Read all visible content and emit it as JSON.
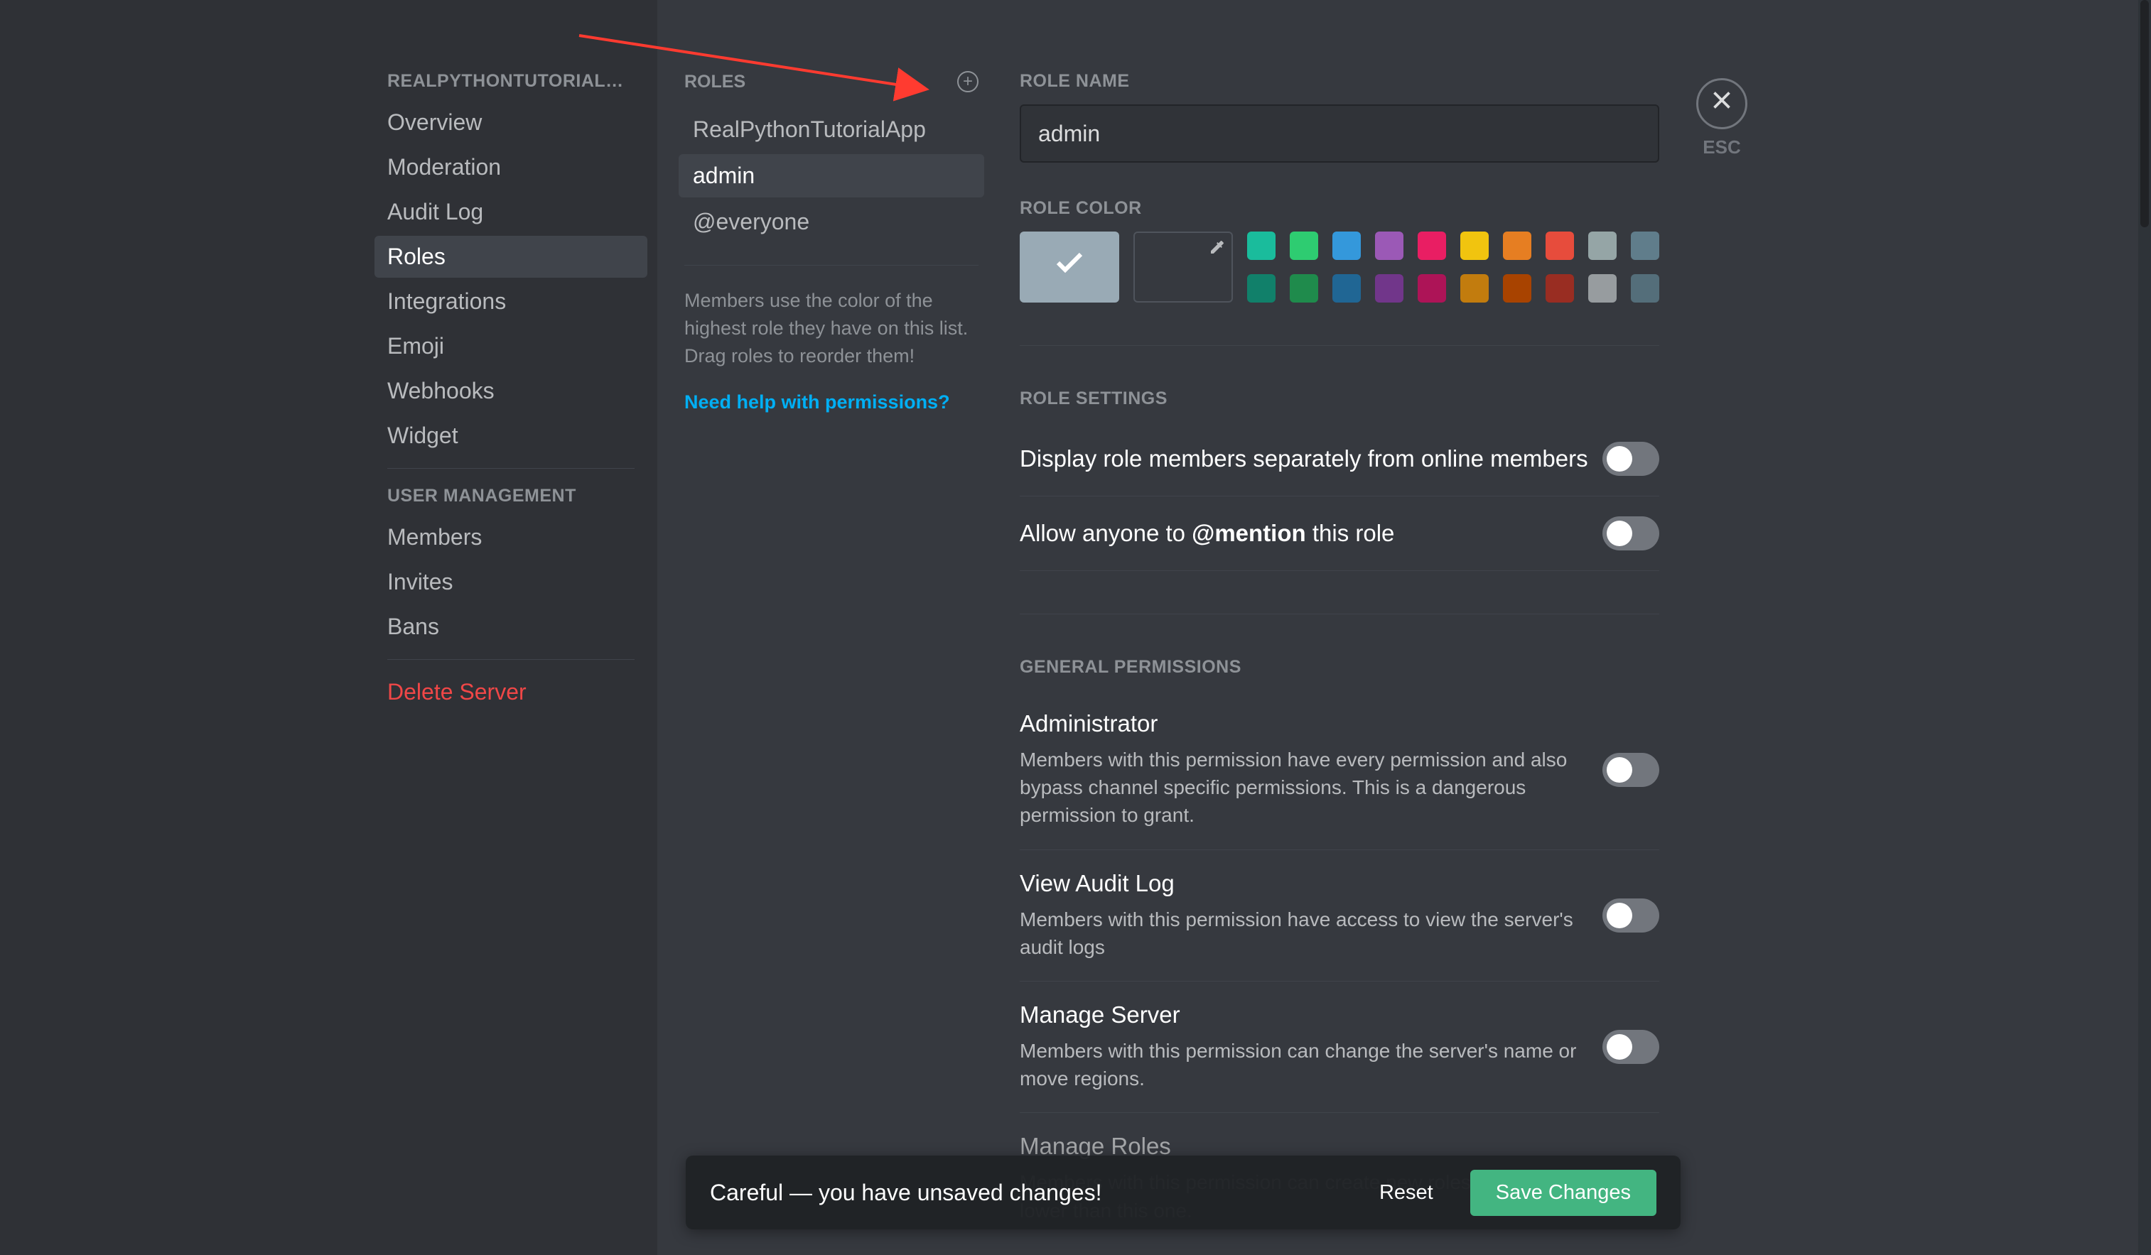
{
  "sidebar": {
    "server_name": "REALPYTHONTUTORIALSERV...",
    "items": [
      {
        "label": "Overview"
      },
      {
        "label": "Moderation"
      },
      {
        "label": "Audit Log"
      },
      {
        "label": "Roles",
        "active": true
      },
      {
        "label": "Integrations"
      },
      {
        "label": "Emoji"
      },
      {
        "label": "Webhooks"
      },
      {
        "label": "Widget"
      }
    ],
    "user_mgmt_header": "User Management",
    "user_mgmt": [
      {
        "label": "Members"
      },
      {
        "label": "Invites"
      },
      {
        "label": "Bans"
      }
    ],
    "delete_label": "Delete Server"
  },
  "roles_col": {
    "header": "Roles",
    "list": [
      {
        "label": "RealPythonTutorialApp"
      },
      {
        "label": "admin",
        "selected": true
      },
      {
        "label": "@everyone"
      }
    ],
    "hint": "Members use the color of the highest role they have on this list. Drag roles to reorder them!",
    "help": "Need help with permissions?"
  },
  "main": {
    "role_name_label": "Role Name",
    "role_name_value": "admin",
    "role_color_label": "Role Color",
    "colors_row1": [
      "#1abc9c",
      "#2ecc71",
      "#3498db",
      "#9b59b6",
      "#e91e63",
      "#f1c40f",
      "#e67e22",
      "#e74c3c",
      "#95a5a6",
      "#607d8b"
    ],
    "colors_row2": [
      "#11806a",
      "#1f8b4c",
      "#206694",
      "#71368a",
      "#ad1457",
      "#c27c0e",
      "#a84300",
      "#992d22",
      "#979c9f",
      "#546e7a"
    ],
    "role_settings_label": "Role Settings",
    "setting_display": "Display role members separately from online members",
    "setting_mention_pre": "Allow anyone to ",
    "setting_mention_bold": "@mention",
    "setting_mention_post": " this role",
    "general_perms_label": "General Permissions",
    "perm_admin_title": "Administrator",
    "perm_admin_desc": "Members with this permission have every permission and also bypass channel specific permissions. This is a dangerous permission to grant.",
    "perm_audit_title": "View Audit Log",
    "perm_audit_desc": "Members with this permission have access to view the server's audit logs",
    "perm_manage_server_title": "Manage Server",
    "perm_manage_server_desc": "Members with this permission can change the server's name or move regions.",
    "perm_manage_roles_title": "Manage Roles",
    "perm_manage_roles_desc": "Members with this permission can create new roles and edit/delete roles lower than this one.",
    "esc": "ESC"
  },
  "unsaved": {
    "msg": "Careful — you have unsaved changes!",
    "reset": "Reset",
    "save": "Save Changes"
  }
}
